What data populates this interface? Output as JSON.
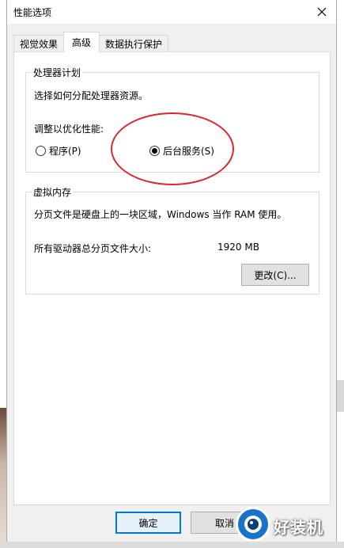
{
  "window": {
    "title": "性能选项",
    "close_icon": "close-icon"
  },
  "tabs": [
    {
      "label": "视觉效果"
    },
    {
      "label": "高级",
      "active": true
    },
    {
      "label": "数据执行保护"
    }
  ],
  "processor_scheduling": {
    "group_label": "处理器计划",
    "description": "选择如何分配处理器资源。",
    "adjust_label": "调整以优化性能:",
    "options": [
      {
        "label": "程序(P)",
        "selected": false
      },
      {
        "label": "后台服务(S)",
        "selected": true
      }
    ]
  },
  "virtual_memory": {
    "group_label": "虚拟内存",
    "description": "分页文件是硬盘上的一块区域，Windows 当作 RAM 使用。",
    "total_label": "所有驱动器总分页文件大小:",
    "total_value": "1920 MB",
    "change_button": "更改(C)..."
  },
  "footer": {
    "ok_button": "确定",
    "cancel_button": "取消"
  },
  "annotation": {
    "color": "#e0242b"
  },
  "watermark": {
    "text": "好装机",
    "color": "#1a73c8"
  }
}
